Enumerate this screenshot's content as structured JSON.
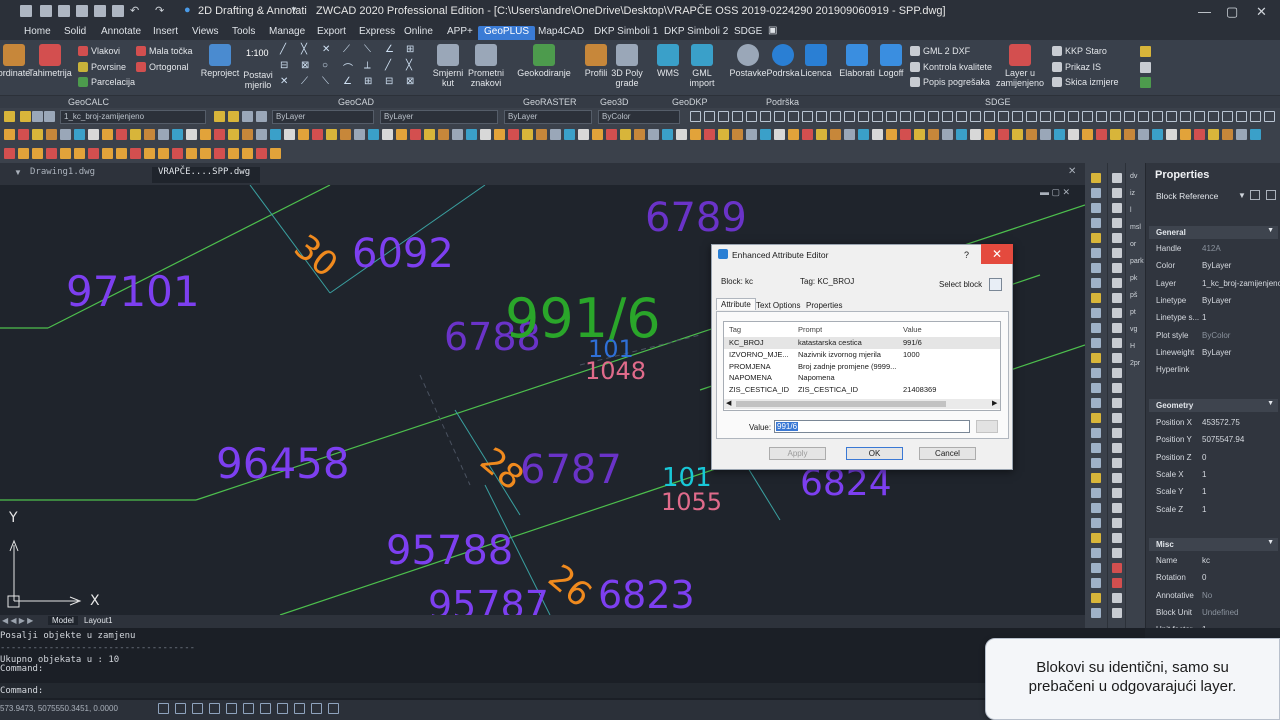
{
  "titlebar": {
    "workspace": "2D Drafting & Annotati",
    "title": "ZWCAD 2020 Professional Edition - [C:\\Users\\andre\\OneDrive\\Desktop\\VRAPČE OSS 2019-0224290 201909060919 - SPP.dwg]"
  },
  "ribbon_tabs": [
    "Home",
    "Solid",
    "Annotate",
    "Insert",
    "Views",
    "Tools",
    "Manage",
    "Export",
    "Express",
    "Online",
    "APP+",
    "GeoPLUS",
    "Map4CAD",
    "DKP Simboli 1",
    "DKP Simboli 2",
    "SDGE"
  ],
  "ribbon_active_tab": "GeoPLUS",
  "ribbon": {
    "rb_ordinate": "ordinate",
    "rb_tahimetrija": "Tahimetrija",
    "sm_vlakovi": "Vlakovi",
    "sm_povrsine": "Povrsine",
    "sm_parcelacija": "Parcelacija",
    "sm_mala_tocka": "Mala točka",
    "sm_ortogonal": "Ortogonal",
    "scale": "1:100",
    "rb_reproject": "Reproject",
    "rb_postavi": "Postavi mjerilo",
    "rb_smjerni": "Smjerni kut",
    "rb_prometni": "Prometni znakovi",
    "rb_geokodiranje": "Geokodiranje",
    "rb_profili": "Profili",
    "rb_3dpoly": "3D Poly grade",
    "rb_wms": "WMS",
    "rb_gml": "GML import",
    "rb_postavke": "Postavke",
    "rb_podrska": "Podrska",
    "rb_licenca": "Licenca",
    "rb_elaborati": "Elaborati",
    "rb_logoff": "Logoff",
    "sm_gml2dxf": "GML 2 DXF",
    "sm_kontrola": "Kontrola kvalitete",
    "sm_popis": "Popis pogrešaka",
    "rb_layer": "Layer u zamijenjeno",
    "sm_kkp": "KKP Staro",
    "sm_prikaz": "Prikaz IS",
    "sm_skica": "Skica izmjere"
  },
  "panel_labels": [
    "GeoCALC",
    "GeoCAD",
    "GeoRASTER",
    "Geo3D",
    "GeoDKP",
    "Podrška",
    "SDGE"
  ],
  "toolbar": {
    "layer_combo": "1_kc_broj-zamijenjeno",
    "color_combo": "ByLayer",
    "linetype_combo": "ByLayer",
    "lineweight_combo": "ByLayer",
    "plotstyle_combo": "ByColor"
  },
  "doc_tabs": [
    "Drawing1.dwg",
    "VRAPČE....SPP.dwg"
  ],
  "drawing": {
    "labels": [
      {
        "text": "97101",
        "color": "#7d3ff0"
      },
      {
        "text": "6092",
        "color": "#7d3ff0"
      },
      {
        "text": "6789",
        "color": "#6a33c8"
      },
      {
        "text": "991/6",
        "color": "#2aa62a"
      },
      {
        "text": "6788",
        "color": "#6a33c8"
      },
      {
        "text": "101",
        "color": "#2f6fd6"
      },
      {
        "text": "1048",
        "color": "#e06b8b"
      },
      {
        "text": "96458",
        "color": "#7d3ff0"
      },
      {
        "text": "6787",
        "color": "#6a33c8"
      },
      {
        "text": "101",
        "color": "#18c8d8"
      },
      {
        "text": "1055",
        "color": "#e06b8b"
      },
      {
        "text": "6824",
        "color": "#7d3ff0"
      },
      {
        "text": "95788",
        "color": "#7d3ff0"
      },
      {
        "text": "95787",
        "color": "#7d3ff0"
      },
      {
        "text": "6823",
        "color": "#7d3ff0"
      },
      {
        "text": "30",
        "color": "#f08a1e"
      },
      {
        "text": "28",
        "color": "#f08a1e"
      },
      {
        "text": "26",
        "color": "#f08a1e"
      }
    ],
    "ucs_x": "X",
    "ucs_y": "Y"
  },
  "layout_tabs": [
    "Model",
    "Layout1"
  ],
  "command_lines": [
    "Posalji objekte u zamjenu",
    "------------------------------------",
    "Ukupno objekata u : 10",
    "Command:",
    "Command:"
  ],
  "status": {
    "coords": "573.9473, 5075550.3451, 0.0000"
  },
  "vtool_labels": [
    "dv",
    "iz",
    "l",
    "msl",
    "or",
    "park",
    "pk",
    "pš",
    "pt",
    "vg",
    "H",
    "2pr"
  ],
  "properties": {
    "title": "Properties",
    "selection": "Block Reference",
    "sections": {
      "general": "General",
      "geometry": "Geometry",
      "misc": "Misc"
    },
    "general": [
      {
        "key": "Handle",
        "value": "412A"
      },
      {
        "key": "Color",
        "value": "ByLayer"
      },
      {
        "key": "Layer",
        "value": "1_kc_broj-zamijenjeno"
      },
      {
        "key": "Linetype",
        "value": "ByLayer"
      },
      {
        "key": "Linetype s...",
        "value": "1"
      },
      {
        "key": "Plot style",
        "value": "ByColor"
      },
      {
        "key": "Lineweight",
        "value": "ByLayer"
      },
      {
        "key": "Hyperlink",
        "value": ""
      }
    ],
    "geometry": [
      {
        "key": "Position X",
        "value": "453572.75"
      },
      {
        "key": "Position Y",
        "value": "5075547.94"
      },
      {
        "key": "Position Z",
        "value": "0"
      },
      {
        "key": "Scale X",
        "value": "1"
      },
      {
        "key": "Scale Y",
        "value": "1"
      },
      {
        "key": "Scale Z",
        "value": "1"
      }
    ],
    "misc": [
      {
        "key": "Name",
        "value": "kc"
      },
      {
        "key": "Rotation",
        "value": "0"
      },
      {
        "key": "Annotative",
        "value": "No"
      },
      {
        "key": "Block Unit",
        "value": "Undefined"
      },
      {
        "key": "Unit factor",
        "value": "1"
      }
    ]
  },
  "dialog": {
    "title": "Enhanced Attribute Editor",
    "help": "?",
    "close": "✕",
    "block": "Block: kc",
    "tag": "Tag: KC_BROJ",
    "select_block": "Select block",
    "tabs": [
      "Attribute",
      "Text Options",
      "Properties"
    ],
    "columns": [
      "Tag",
      "Prompt",
      "Value"
    ],
    "rows": [
      {
        "tag": "KC_BROJ",
        "prompt": "katastarska cestica",
        "value": "991/6"
      },
      {
        "tag": "IZVORNO_MJE...",
        "prompt": "Nazivnik izvornog mjerila",
        "value": "1000"
      },
      {
        "tag": "PROMJENA",
        "prompt": "Broj zadnje promjene (9999...",
        "value": ""
      },
      {
        "tag": "NAPOMENA",
        "prompt": "Napomena",
        "value": ""
      },
      {
        "tag": "ZIS_CESTICA_ID",
        "prompt": "ZIS_CESTICA_ID",
        "value": "21408369"
      }
    ],
    "value_label": "Value:",
    "value": "991/6",
    "apply": "Apply",
    "ok": "OK",
    "cancel": "Cancel"
  },
  "callout": {
    "line1": "Blokovi su identični, samo su",
    "line2": "prebačeni u odgovarajući layer."
  }
}
